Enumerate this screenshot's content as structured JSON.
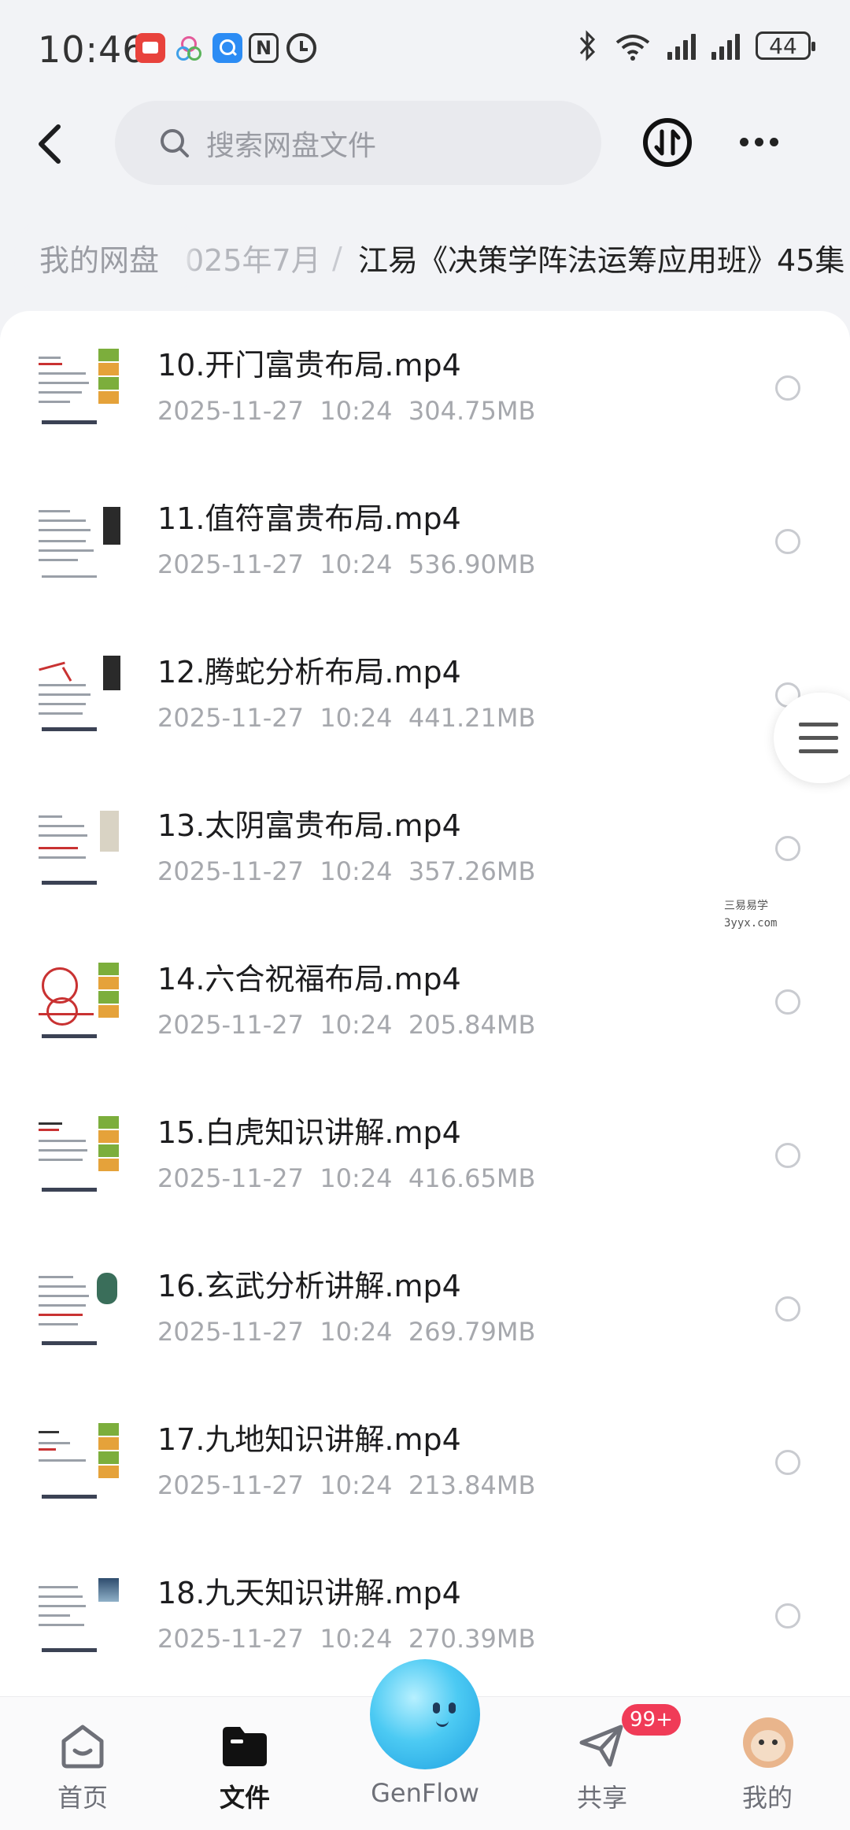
{
  "status_bar": {
    "time": "10:46",
    "battery": "44",
    "app_icons": [
      {
        "name": "red-app-icon",
        "color": "#e8423c"
      },
      {
        "name": "flower-app-icon",
        "color": "#e45a9a"
      },
      {
        "name": "blue-search-app-icon",
        "color": "#2c8cf4"
      },
      {
        "name": "nfc-icon",
        "color": "#333333"
      },
      {
        "name": "alarm-icon",
        "color": "#333333"
      }
    ]
  },
  "search": {
    "placeholder": "搜索网盘文件"
  },
  "breadcrumb": {
    "root": "我的网盘",
    "middle": "025年7月",
    "separator": "/",
    "current": "江易《决策学阵法运筹应用班》45集"
  },
  "files": [
    {
      "name": "10.开门富贵布局.mp4",
      "date": "2025-11-27",
      "time": "10:24",
      "size": "304.75MB"
    },
    {
      "name": "11.值符富贵布局.mp4",
      "date": "2025-11-27",
      "time": "10:24",
      "size": "536.90MB"
    },
    {
      "name": "12.腾蛇分析布局.mp4",
      "date": "2025-11-27",
      "time": "10:24",
      "size": "441.21MB"
    },
    {
      "name": "13.太阴富贵布局.mp4",
      "date": "2025-11-27",
      "time": "10:24",
      "size": "357.26MB"
    },
    {
      "name": "14.六合祝福布局.mp4",
      "date": "2025-11-27",
      "time": "10:24",
      "size": "205.84MB"
    },
    {
      "name": "15.白虎知识讲解.mp4",
      "date": "2025-11-27",
      "time": "10:24",
      "size": "416.65MB"
    },
    {
      "name": "16.玄武分析讲解.mp4",
      "date": "2025-11-27",
      "time": "10:24",
      "size": "269.79MB"
    },
    {
      "name": "17.九地知识讲解.mp4",
      "date": "2025-11-27",
      "time": "10:24",
      "size": "213.84MB"
    },
    {
      "name": "18.九天知识讲解.mp4",
      "date": "2025-11-27",
      "time": "10:24",
      "size": "270.39MB"
    }
  ],
  "watermark": {
    "line1": "三易易学",
    "line2": "3yyx.com"
  },
  "tabs": [
    {
      "label": "首页",
      "icon": "home-icon",
      "active": false
    },
    {
      "label": "文件",
      "icon": "folder-icon",
      "active": true
    },
    {
      "label": "GenFlow",
      "icon": "genflow-ball-icon",
      "active": false
    },
    {
      "label": "共享",
      "icon": "share-plane-icon",
      "active": false
    },
    {
      "label": "我的",
      "icon": "avatar-icon",
      "active": false
    }
  ],
  "share_badge": "99+",
  "colors": {
    "accent": "#1a1a1a",
    "badge": "#f03b57",
    "genflow": "#34b8ee"
  }
}
